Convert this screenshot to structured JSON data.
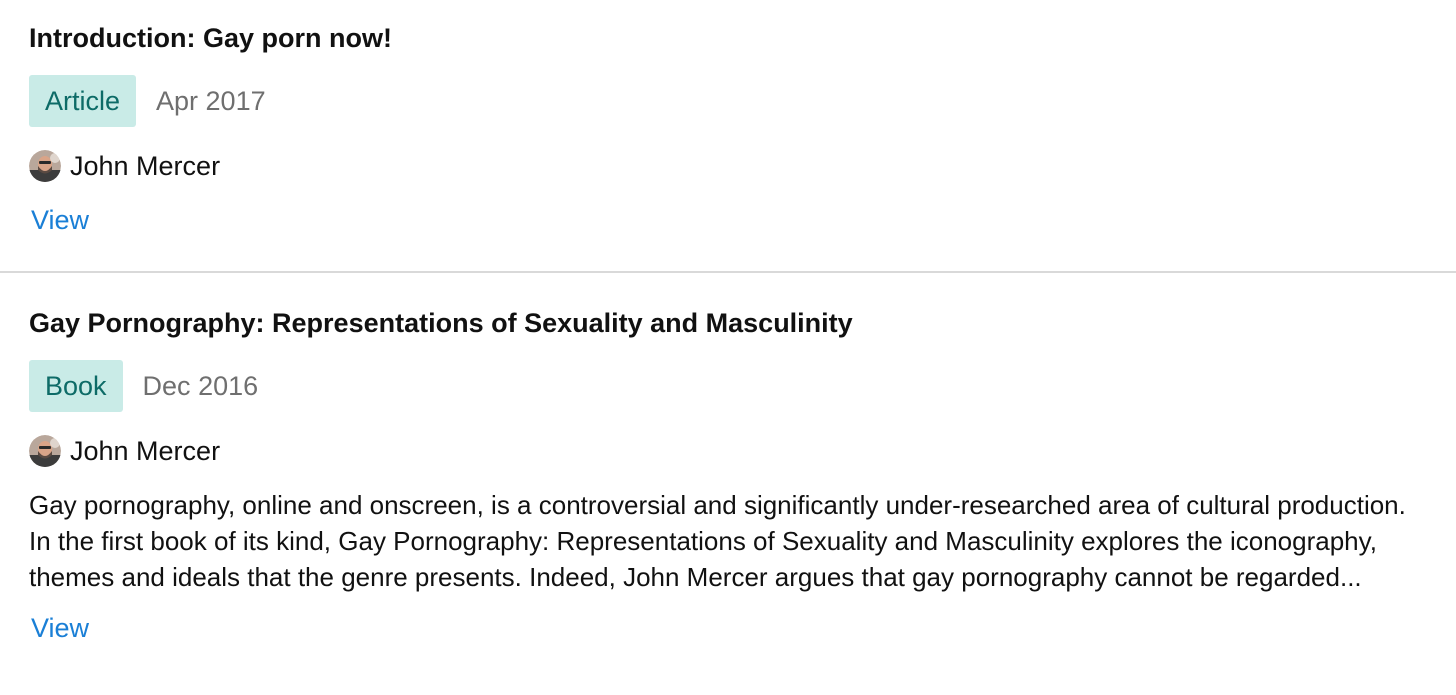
{
  "publications": [
    {
      "title": "Introduction: Gay porn now!",
      "type": "Article",
      "date": "Apr 2017",
      "author": "John Mercer",
      "view_label": "View"
    },
    {
      "title": "Gay Pornography: Representations of Sexuality and Masculinity",
      "type": "Book",
      "date": "Dec 2016",
      "author": "John Mercer",
      "description": "Gay pornography, online and onscreen, is a controversial and significantly under-researched area of cultural production. In the first book of its kind, Gay Pornography: Representations of Sexuality and Masculinity explores the iconography, themes and ideals that the genre presents. Indeed, John Mercer argues that gay pornography cannot be regarded...",
      "view_label": "View"
    }
  ],
  "colors": {
    "badge_bg": "#c9ebe7",
    "badge_text": "#0d6b67",
    "link": "#1a7fd6",
    "date_text": "#6f6f6f",
    "divider": "#d9d9d9"
  },
  "icons": {
    "avatar": "author-avatar-icon"
  }
}
